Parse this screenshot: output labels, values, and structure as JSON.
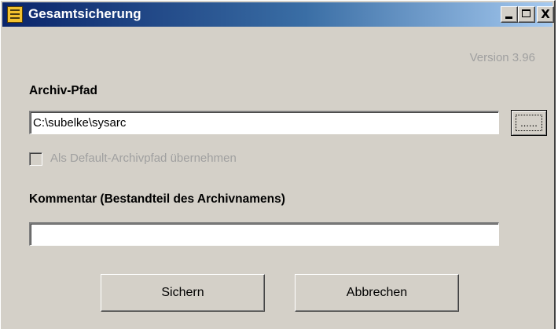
{
  "window": {
    "title": "Gesamtsicherung",
    "minimize_label": "",
    "maximize_label": "",
    "close_label": "X"
  },
  "version": "Version 3.96",
  "archive": {
    "label": "Archiv-Pfad",
    "path_value": "C:\\subelke\\sysarc",
    "browse_label": "......",
    "default_checkbox_label": "Als Default-Archivpfad übernehmen",
    "default_checked": false
  },
  "comment": {
    "label": "Kommentar (Bestandteil des Archivnamens)",
    "value": ""
  },
  "buttons": {
    "save": "Sichern",
    "cancel": "Abbrechen"
  },
  "colors": {
    "titlebar_start": "#0a246a",
    "titlebar_end": "#a6caf0",
    "dialog_background": "#d4d0c8",
    "disabled_text": "#a0a0a0"
  },
  "icons": {
    "app": "app-icon",
    "minimize": "minimize-icon",
    "maximize": "maximize-icon",
    "close": "close-icon"
  }
}
